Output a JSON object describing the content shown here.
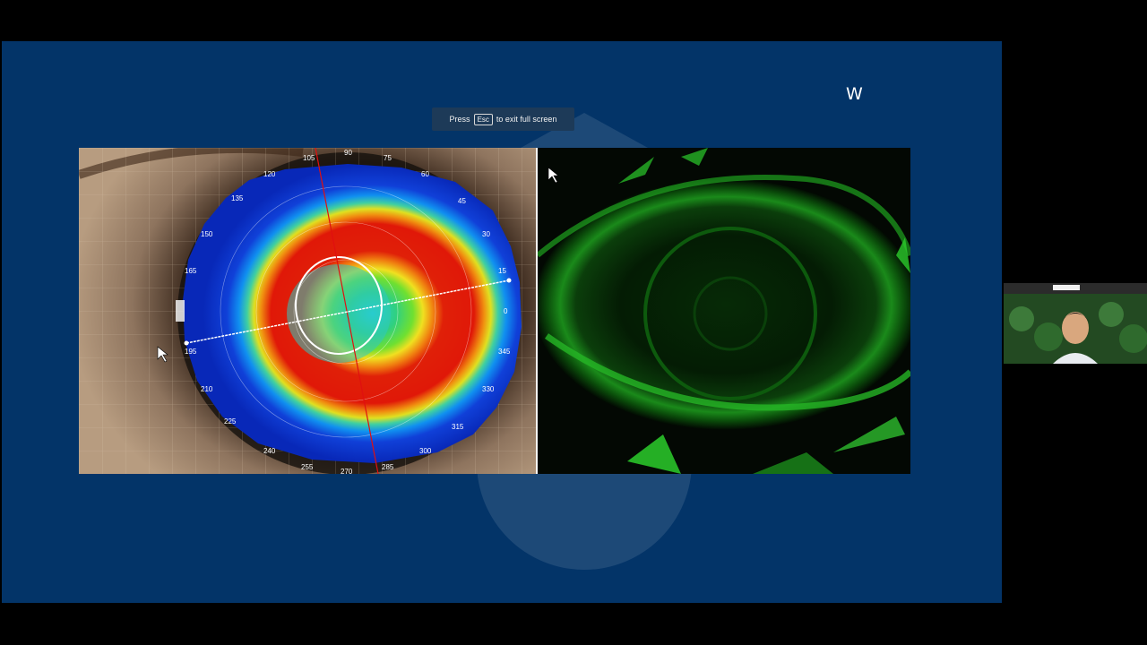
{
  "fullscreen_notice": {
    "prefix": "Press",
    "key": "Esc",
    "suffix": "to exit full screen"
  },
  "brand": {
    "logo_text": "W"
  },
  "topography": {
    "axis_angles": [
      "90",
      "105",
      "75",
      "120",
      "60",
      "135",
      "45",
      "150",
      "30",
      "165",
      "15",
      "0",
      "195",
      "345",
      "210",
      "330",
      "225",
      "315",
      "240",
      "300",
      "255",
      "285",
      "270"
    ]
  },
  "colors": {
    "slide_bg": "#033468",
    "page_bg": "#000000",
    "map_blue": "#1030c8",
    "map_red": "#e01808",
    "map_green": "#40d040",
    "fluorescein": "#20c020"
  }
}
